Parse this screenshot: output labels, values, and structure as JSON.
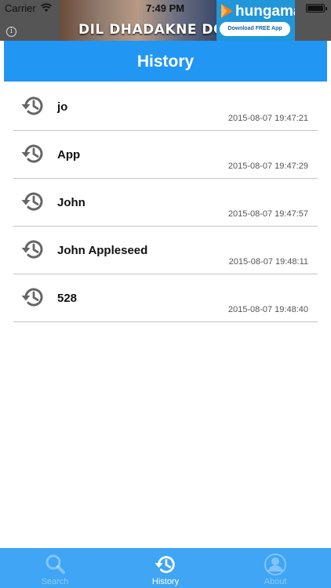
{
  "status_bar": {
    "carrier": "Carrier",
    "time": "7:49 PM"
  },
  "ad": {
    "title": "DIL DHADAKNE DO",
    "brand": "hungama",
    "cta": "Download FREE App",
    "info": "i"
  },
  "header": {
    "title": "History"
  },
  "history": [
    {
      "title": "jo",
      "time": "2015-08-07 19:47:21"
    },
    {
      "title": "App",
      "time": "2015-08-07 19:47:29"
    },
    {
      "title": "John",
      "time": "2015-08-07 19:47:57"
    },
    {
      "title": "John Appleseed",
      "time": "2015-08-07 19:48:11"
    },
    {
      "title": "528",
      "time": "2015-08-07 19:48:40"
    }
  ],
  "tabs": [
    {
      "label": "Search",
      "icon": "search-icon",
      "active": false
    },
    {
      "label": "History",
      "icon": "history-icon",
      "active": true
    },
    {
      "label": "About",
      "icon": "person-icon",
      "active": false
    }
  ],
  "colors": {
    "nav_bar": "#2196f3",
    "tab_bar": "#3fa5f4",
    "divider": "#c4c4c4",
    "icon_gray": "#666666"
  }
}
